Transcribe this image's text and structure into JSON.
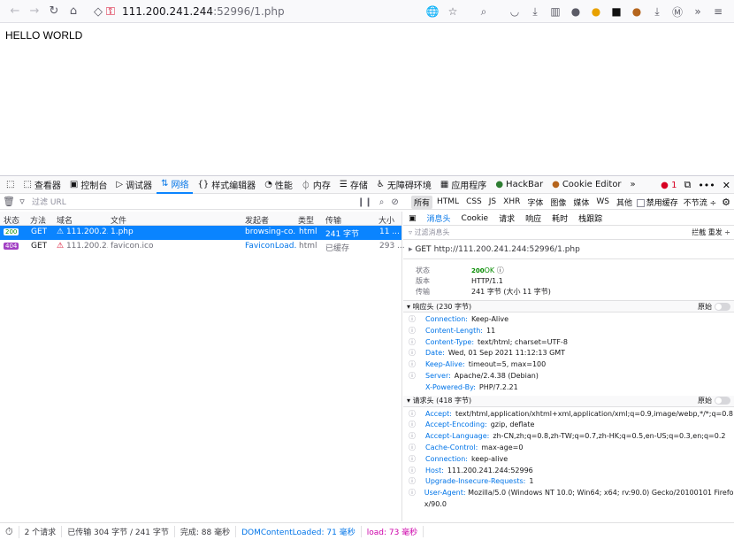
{
  "browser": {
    "url_host": "111.200.241.244",
    "url_rest": ":52996/1.php",
    "nav_icons": [
      "back-icon",
      "forward-icon",
      "reload-icon",
      "home-icon"
    ],
    "toolbar_icons": [
      "translate-icon",
      "star-icon",
      "search-icon",
      "pocket-icon",
      "download-icon",
      "reader-icon",
      "extension-icon",
      "extension-icon",
      "extension-icon",
      "cookie-icon",
      "download-icon",
      "account-icon",
      "overflow-icon",
      "menu-icon"
    ]
  },
  "page": {
    "text": "HELLO WORLD"
  },
  "devtools": {
    "tabs": [
      "查看器",
      "控制台",
      "调试器",
      "网络",
      "样式编辑器",
      "性能",
      "内存",
      "存储",
      "无障碍环境",
      "应用程序",
      "HackBar",
      "Cookie Editor"
    ],
    "selected_tab": "网络",
    "error_count": "1",
    "filter_placeholder": "过滤 URL",
    "filter_types": [
      "所有",
      "HTML",
      "CSS",
      "JS",
      "XHR",
      "字体",
      "图像",
      "媒体",
      "WS",
      "其他"
    ],
    "disable_cache": "禁用缓存",
    "throttle": "不节流 ÷",
    "columns": [
      "状态",
      "方法",
      "域名",
      "文件",
      "发起者",
      "类型",
      "传输",
      "大小"
    ],
    "rows": [
      {
        "status": "200",
        "method": "GET",
        "domain": "111.200.2...",
        "file": "1.php",
        "initiator": "browsing-co...",
        "type": "html",
        "transfer": "241 字节",
        "size": "11 ..."
      },
      {
        "status": "404",
        "method": "GET",
        "domain": "111.200.2...",
        "file": "favicon.ico",
        "initiator": "FaviconLoad...",
        "type": "html",
        "transfer": "已缓存",
        "size": "293 ..."
      }
    ],
    "statusbar": {
      "requests": "2 个请求",
      "transferred": "已传输 304 字节 / 241 字节",
      "finish": "完成: 88 毫秒",
      "dcl": "DOMContentLoaded: 71 毫秒",
      "load": "load: 73 毫秒"
    },
    "detail_tabs": [
      "消息头",
      "Cookie",
      "请求",
      "响应",
      "耗时",
      "栈跟踪"
    ],
    "detail_filter": "过滤消息头",
    "detail_filter_right": "拦截 重发 ÷",
    "request_line": {
      "method": "GET",
      "url": "http://111.200.241.244:52996/1.php"
    },
    "summary": {
      "status_label": "状态",
      "status_code": "200",
      "status_text": "OK",
      "version_label": "版本",
      "version": "HTTP/1.1",
      "transfer_label": "传输",
      "transfer": "241 字节 (大小 11 字节)"
    },
    "response_title": "响应头 (230 字节)",
    "raw_label": "原始",
    "response_headers": [
      {
        "name": "Connection:",
        "value": "Keep-Alive"
      },
      {
        "name": "Content-Length:",
        "value": "11"
      },
      {
        "name": "Content-Type:",
        "value": "text/html; charset=UTF-8"
      },
      {
        "name": "Date:",
        "value": "Wed, 01 Sep 2021 11:12:13 GMT"
      },
      {
        "name": "Keep-Alive:",
        "value": "timeout=5, max=100"
      },
      {
        "name": "Server:",
        "value": "Apache/2.4.38 (Debian)"
      },
      {
        "name": "X-Powered-By:",
        "value": "PHP/7.2.21"
      }
    ],
    "request_title": "请求头 (418 字节)",
    "request_headers": [
      {
        "name": "Accept:",
        "value": "text/html,application/xhtml+xml,application/xml;q=0.9,image/webp,*/*;q=0.8"
      },
      {
        "name": "Accept-Encoding:",
        "value": "gzip, deflate"
      },
      {
        "name": "Accept-Language:",
        "value": "zh-CN,zh;q=0.8,zh-TW;q=0.7,zh-HK;q=0.5,en-US;q=0.3,en;q=0.2"
      },
      {
        "name": "Cache-Control:",
        "value": "max-age=0"
      },
      {
        "name": "Connection:",
        "value": "keep-alive"
      },
      {
        "name": "Host:",
        "value": "111.200.241.244:52996"
      },
      {
        "name": "Upgrade-Insecure-Requests:",
        "value": "1"
      },
      {
        "name": "User-Agent:",
        "value": "Mozilla/5.0 (Windows NT 10.0; Win64; x64; rv:90.0) Gecko/20100101 Firefox/90.0"
      }
    ]
  }
}
